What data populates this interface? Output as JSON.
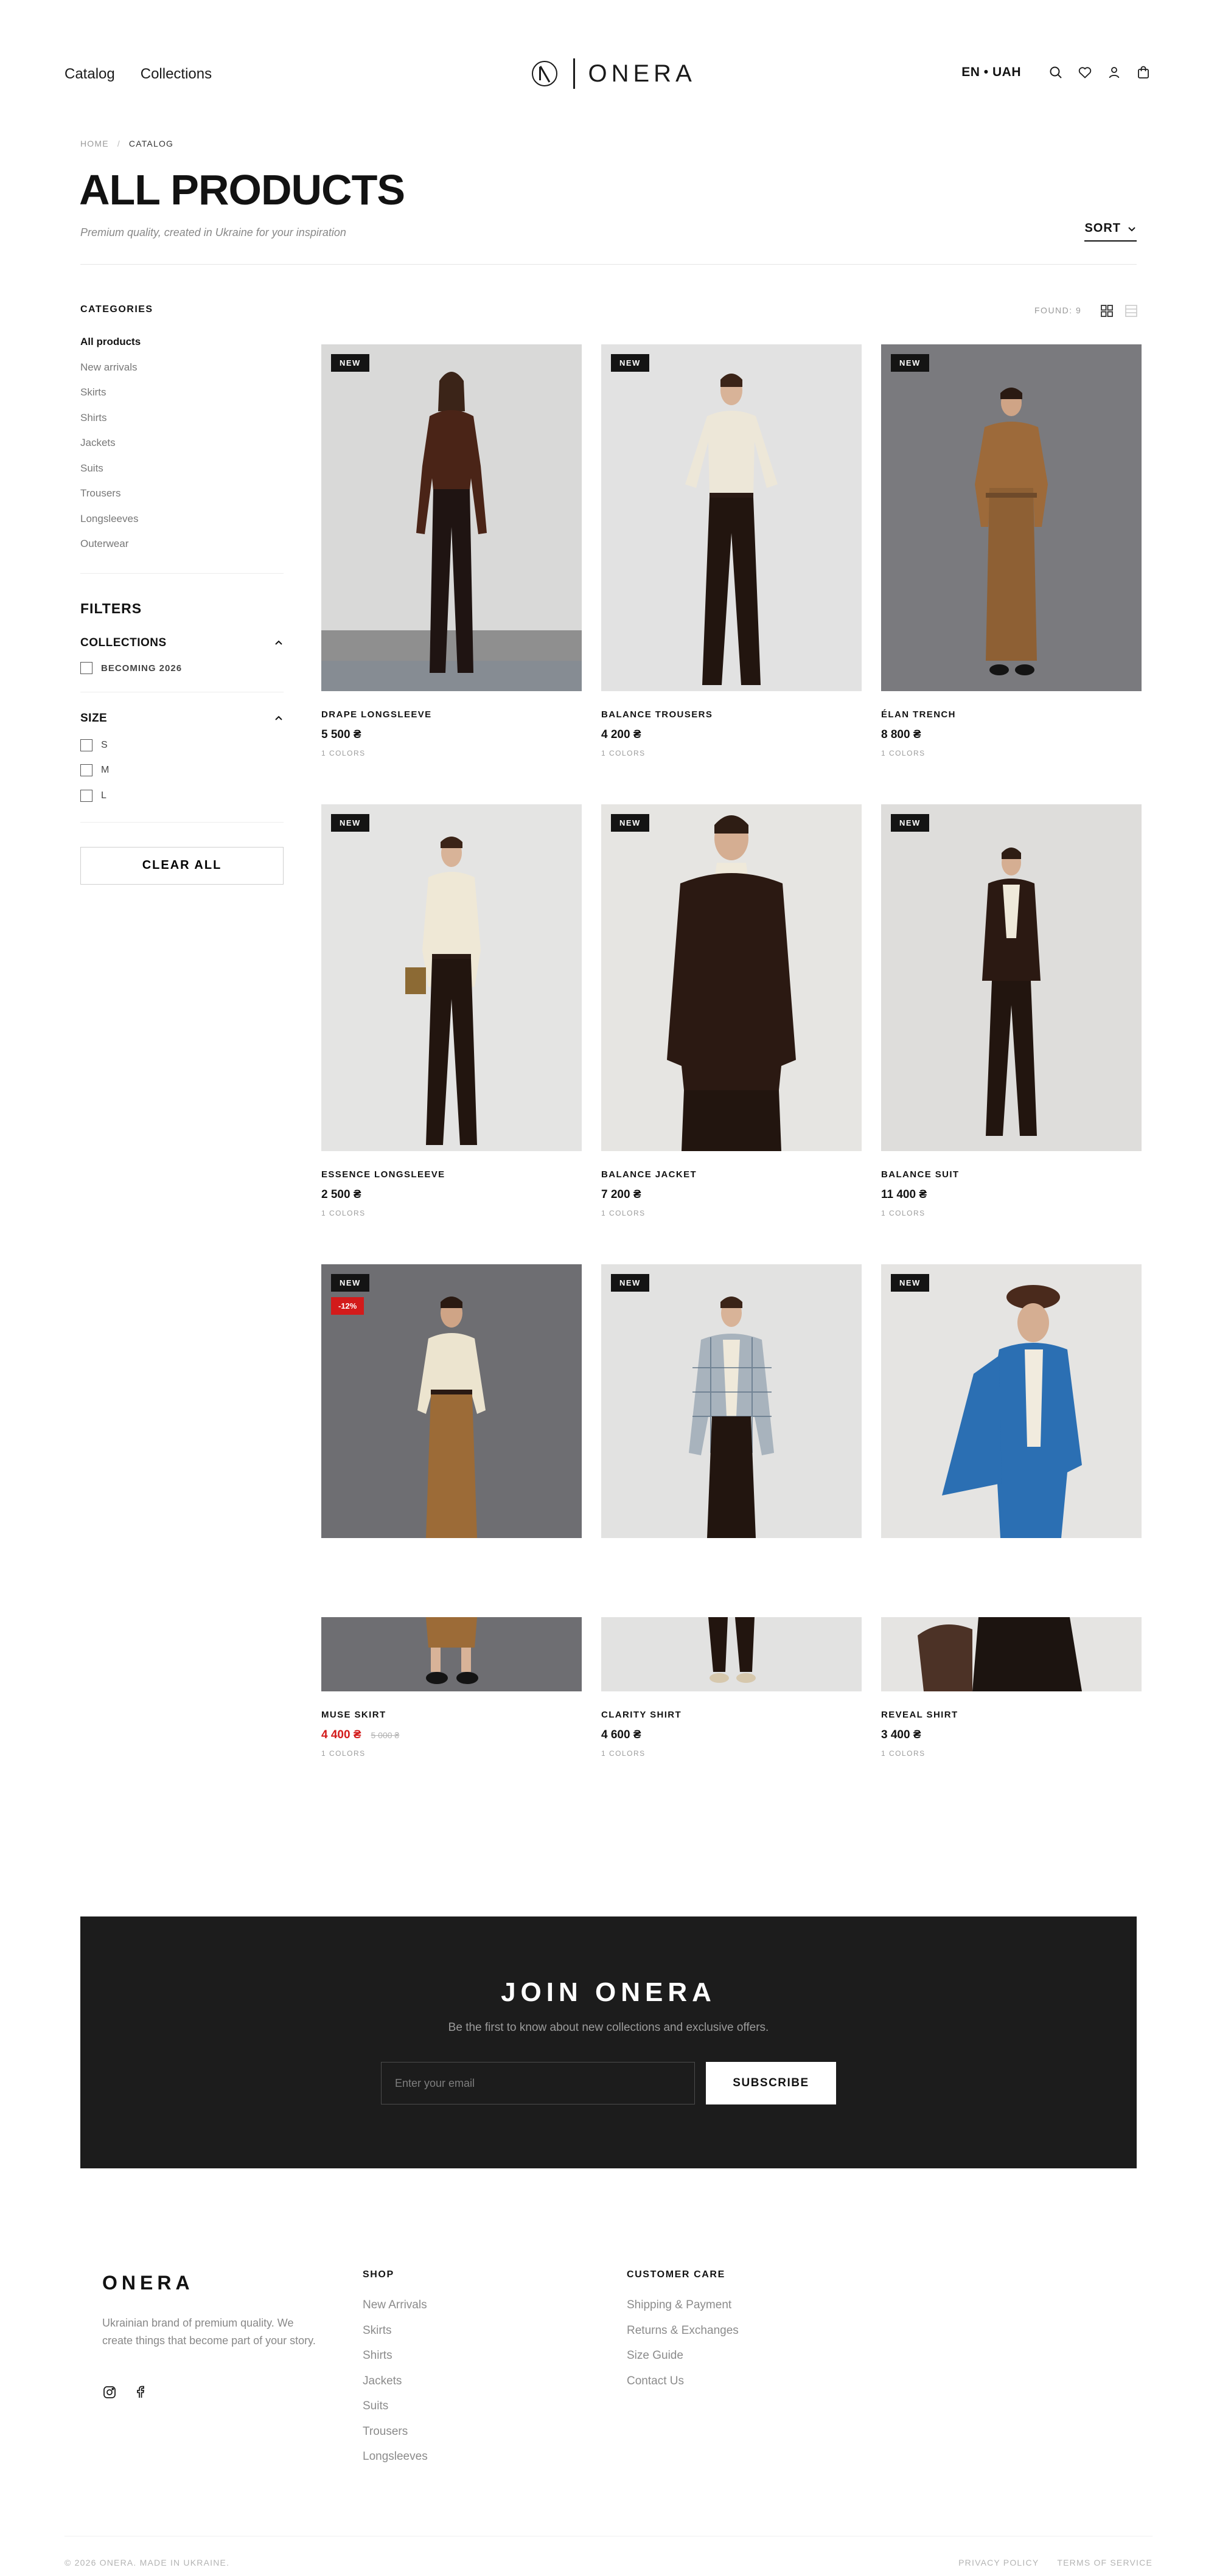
{
  "header": {
    "nav": [
      {
        "label": "Catalog"
      },
      {
        "label": "Collections"
      }
    ],
    "logo_text": "ONERA",
    "lang_currency": "EN • UAH",
    "icons": [
      "search-icon",
      "heart-icon",
      "user-icon",
      "cart-icon"
    ]
  },
  "breadcrumb": {
    "home": "HOME",
    "separator": "/",
    "current": "CATALOG"
  },
  "page": {
    "title": "ALL PRODUCTS",
    "subtitle": "Premium quality, created in Ukraine for your inspiration",
    "sort_label": "SORT"
  },
  "sidebar": {
    "categories_heading": "CATEGORIES",
    "categories": [
      {
        "label": "All products",
        "active": true
      },
      {
        "label": "New arrivals"
      },
      {
        "label": "Skirts"
      },
      {
        "label": "Shirts"
      },
      {
        "label": "Jackets"
      },
      {
        "label": "Suits"
      },
      {
        "label": "Trousers"
      },
      {
        "label": "Longsleeves"
      },
      {
        "label": "Outerwear"
      }
    ],
    "filters_heading": "FILTERS",
    "collections_heading": "COLLECTIONS",
    "collections": [
      {
        "label": "BECOMING 2026",
        "checked": false
      }
    ],
    "size_heading": "SIZE",
    "sizes": [
      {
        "label": "S"
      },
      {
        "label": "M"
      },
      {
        "label": "L"
      }
    ],
    "clear_label": "CLEAR ALL"
  },
  "results": {
    "found_label": "FOUND: 9"
  },
  "products": [
    {
      "name": "DRAPE LONGSLEEVE",
      "price": "5 500 ₴",
      "colors": "1 COLORS",
      "badge": "NEW"
    },
    {
      "name": "BALANCE TROUSERS",
      "price": "4 200 ₴",
      "colors": "1 COLORS",
      "badge": "NEW"
    },
    {
      "name": "ÉLAN TRENCH",
      "price": "8 800 ₴",
      "colors": "1 COLORS",
      "badge": "NEW"
    },
    {
      "name": "ESSENCE LONGSLEEVE",
      "price": "2 500 ₴",
      "colors": "1 COLORS",
      "badge": "NEW"
    },
    {
      "name": "BALANCE JACKET",
      "price": "7 200 ₴",
      "colors": "1 COLORS",
      "badge": "NEW"
    },
    {
      "name": "BALANCE SUIT",
      "price": "11 400 ₴",
      "colors": "1 COLORS",
      "badge": "NEW"
    },
    {
      "name": "MUSE SKIRT",
      "price": "4 400 ₴",
      "old_price": "5 000 ₴",
      "discount": "-12%",
      "colors": "1 COLORS",
      "badge": "NEW"
    },
    {
      "name": "CLARITY SHIRT",
      "price": "4 600 ₴",
      "colors": "1 COLORS",
      "badge": "NEW"
    },
    {
      "name": "REVEAL SHIRT",
      "price": "3 400 ₴",
      "colors": "1 COLORS",
      "badge": "NEW"
    }
  ],
  "newsletter": {
    "title": "JOIN ONERA",
    "subtitle": "Be the first to know about new collections and exclusive offers.",
    "placeholder": "Enter your email",
    "button": "SUBSCRIBE"
  },
  "footer": {
    "logo": "ONERA",
    "description": "Ukrainian brand of premium quality. We create things that become part of your story.",
    "social_icons": [
      "instagram-icon",
      "facebook-icon"
    ],
    "shop_heading": "SHOP",
    "shop_links": [
      "New Arrivals",
      "Skirts",
      "Shirts",
      "Jackets",
      "Suits",
      "Trousers",
      "Longsleeves"
    ],
    "care_heading": "CUSTOMER CARE",
    "care_links": [
      "Shipping & Payment",
      "Returns & Exchanges",
      "Size Guide",
      "Contact Us"
    ],
    "copyright": "© 2026 ONERA. MADE IN UKRAINE.",
    "privacy": "PRIVACY POLICY",
    "terms": "TERMS OF SERVICE"
  }
}
